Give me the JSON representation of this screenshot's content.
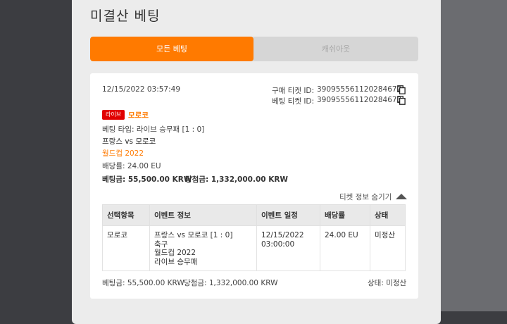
{
  "modal": {
    "title": "미결산 베팅",
    "tabs": [
      {
        "label": "모든 베팅",
        "active": true
      },
      {
        "label": "캐쉬아웃",
        "active": false
      }
    ]
  },
  "ticket": {
    "datetime": "12/15/2022 03:57:49",
    "purchase_id_label": "구매 티켓 ID:",
    "purchase_id": "390955561120284672",
    "bet_id_label": "베팅 티켓 ID:",
    "bet_id": "390955561120284673",
    "live_badge": "라이브",
    "selection": "모로코",
    "bet_type": "베팅 타입: 라이브 승무패 [1 : 0]",
    "match": "프랑스 vs 모로코",
    "league": "월드컵 2022",
    "odds": "배당률: 24.00 EU",
    "stake": "베팅금: 55,500.00 KRW",
    "win": "당첨금: 1,332,000.00 KRW",
    "toggle_label": "티켓 정보 숨기기"
  },
  "table": {
    "headers": [
      "선택항목",
      "이벤트 정보",
      "이벤트 일정",
      "배당률",
      "상태"
    ],
    "row": {
      "selection": "모로코",
      "event_lines": [
        "프랑스 vs 모로코 [1 : 0]",
        "축구",
        "월드컵 2022",
        "라이브 승무패"
      ],
      "date": "12/15/2022",
      "time": "03:00:00",
      "odds": "24.00 EU",
      "status": "미정산"
    }
  },
  "footer": {
    "stake": "베팅금: 55,500.00 KRW",
    "win": "당첨금: 1,332,000.00 KRW",
    "status": "상태: 미정산"
  },
  "colors": {
    "accent": "#ff7a00",
    "live": "#e10000"
  },
  "icons": {
    "copy": "copy-icon",
    "collapse": "triangle-up-icon"
  }
}
